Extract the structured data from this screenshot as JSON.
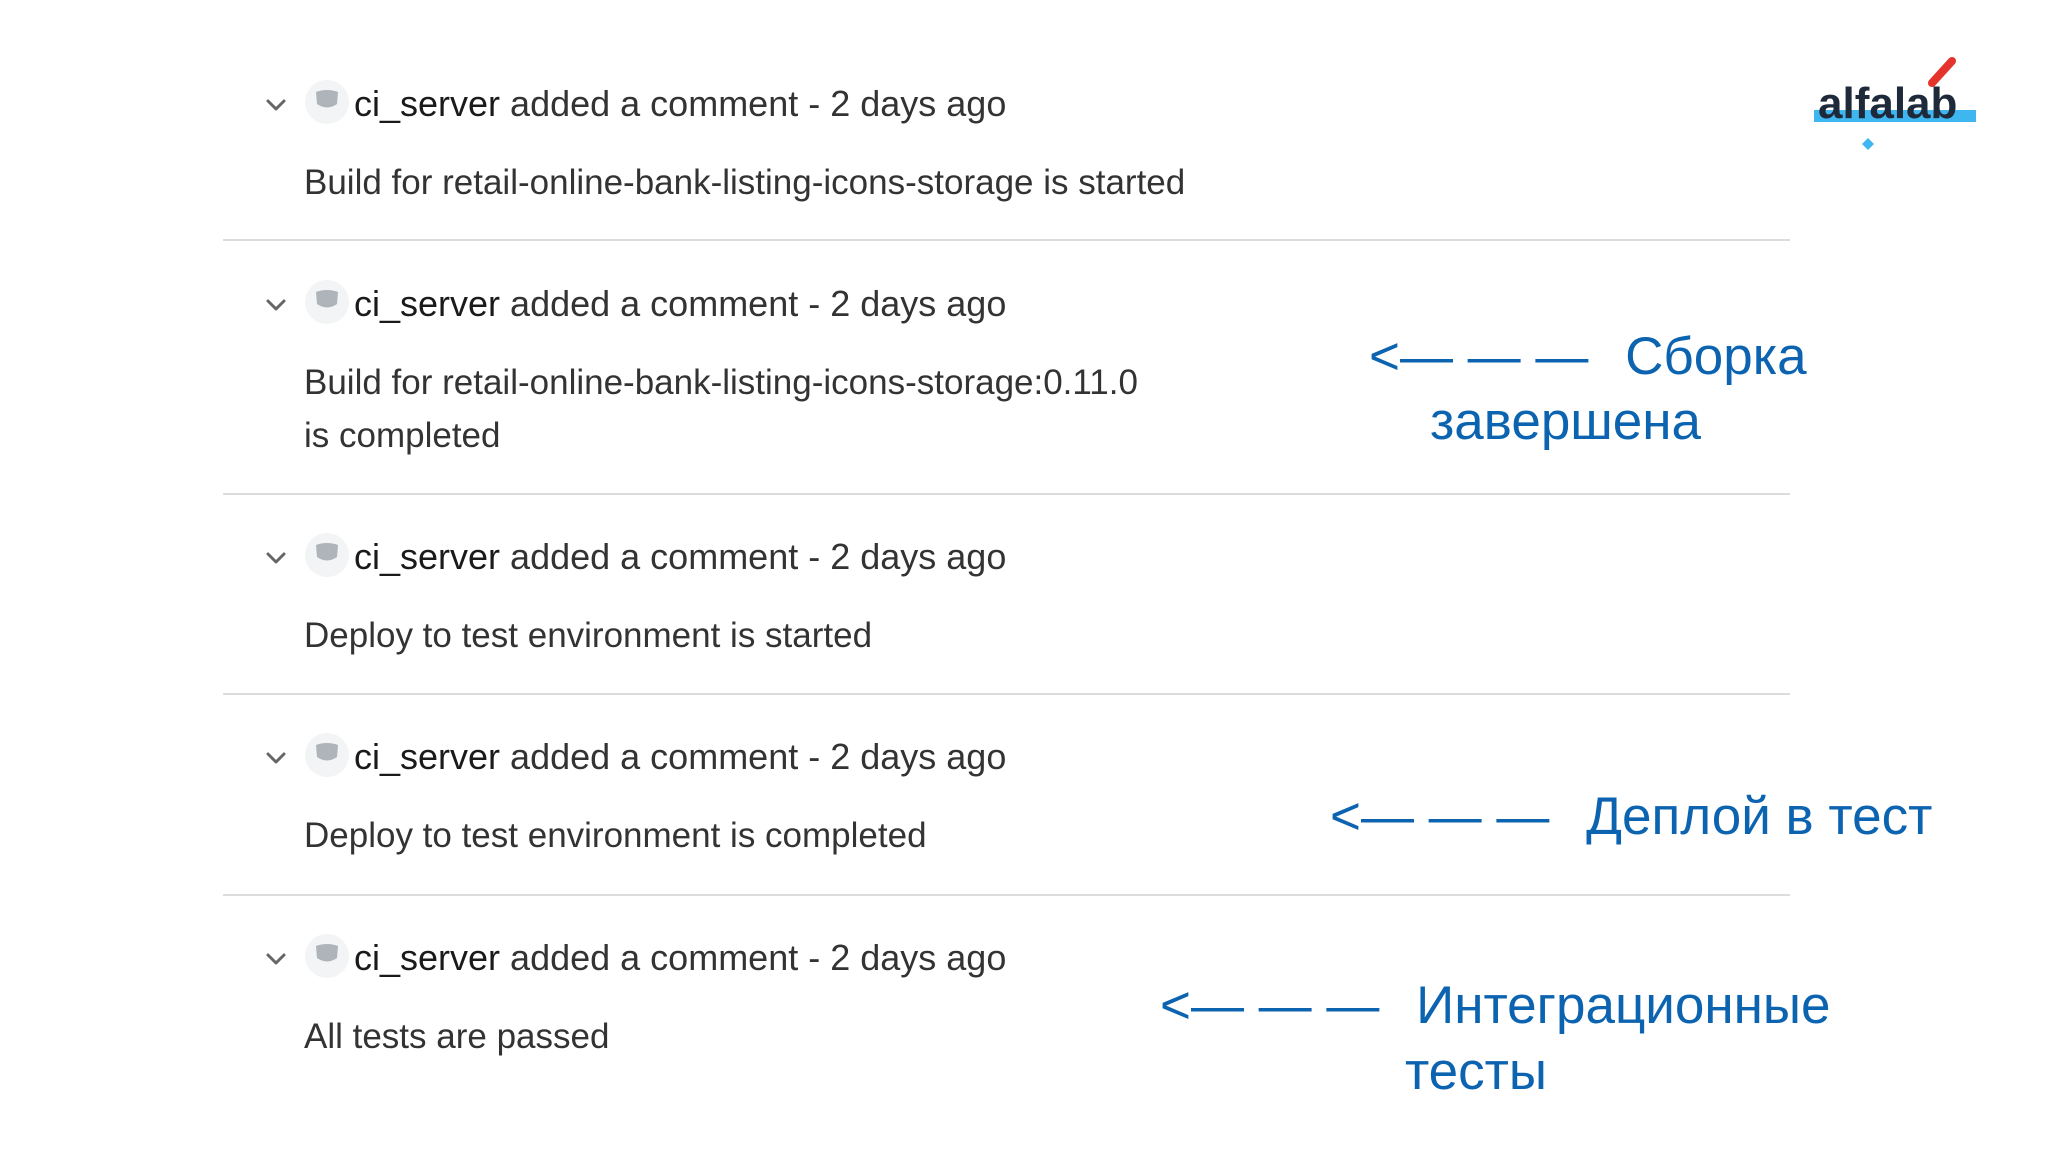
{
  "logo": {
    "text": "alfalab",
    "accent_color": "#e4342b",
    "underline_color": "#3eb6f0"
  },
  "comments": [
    {
      "author": "ci_server",
      "action": " added a comment - 2 days ago",
      "body": "Build for retail-online-bank-listing-icons-storage is started"
    },
    {
      "author": "ci_server",
      "action": " added a comment - 2 days ago",
      "body": "Build for retail-online-bank-listing-icons-storage:0.11.0",
      "body2": "is completed"
    },
    {
      "author": "ci_server",
      "action": " added a comment - 2 days ago",
      "body": "Deploy to test environment is started"
    },
    {
      "author": "ci_server",
      "action": " added a comment - 2 days ago",
      "body": "Deploy to test environment is completed"
    },
    {
      "author": "ci_server",
      "action": " added a comment - 2 days ago",
      "body": "All tests are passed"
    }
  ],
  "annotations": [
    {
      "arrow": "<— — —",
      "line1": "Сборка",
      "line2": "завершена"
    },
    {
      "arrow": "<— — —",
      "line1": "Деплой в тест"
    },
    {
      "arrow": "<— — —",
      "line1": "Интеграционные",
      "line2": "тесты"
    }
  ],
  "icons": {
    "collapse": "chevron-down-icon",
    "avatar": "user-avatar-icon"
  },
  "colors": {
    "annotation": "#0c64b1",
    "divider": "#dcdcdc",
    "text": "#333333"
  }
}
